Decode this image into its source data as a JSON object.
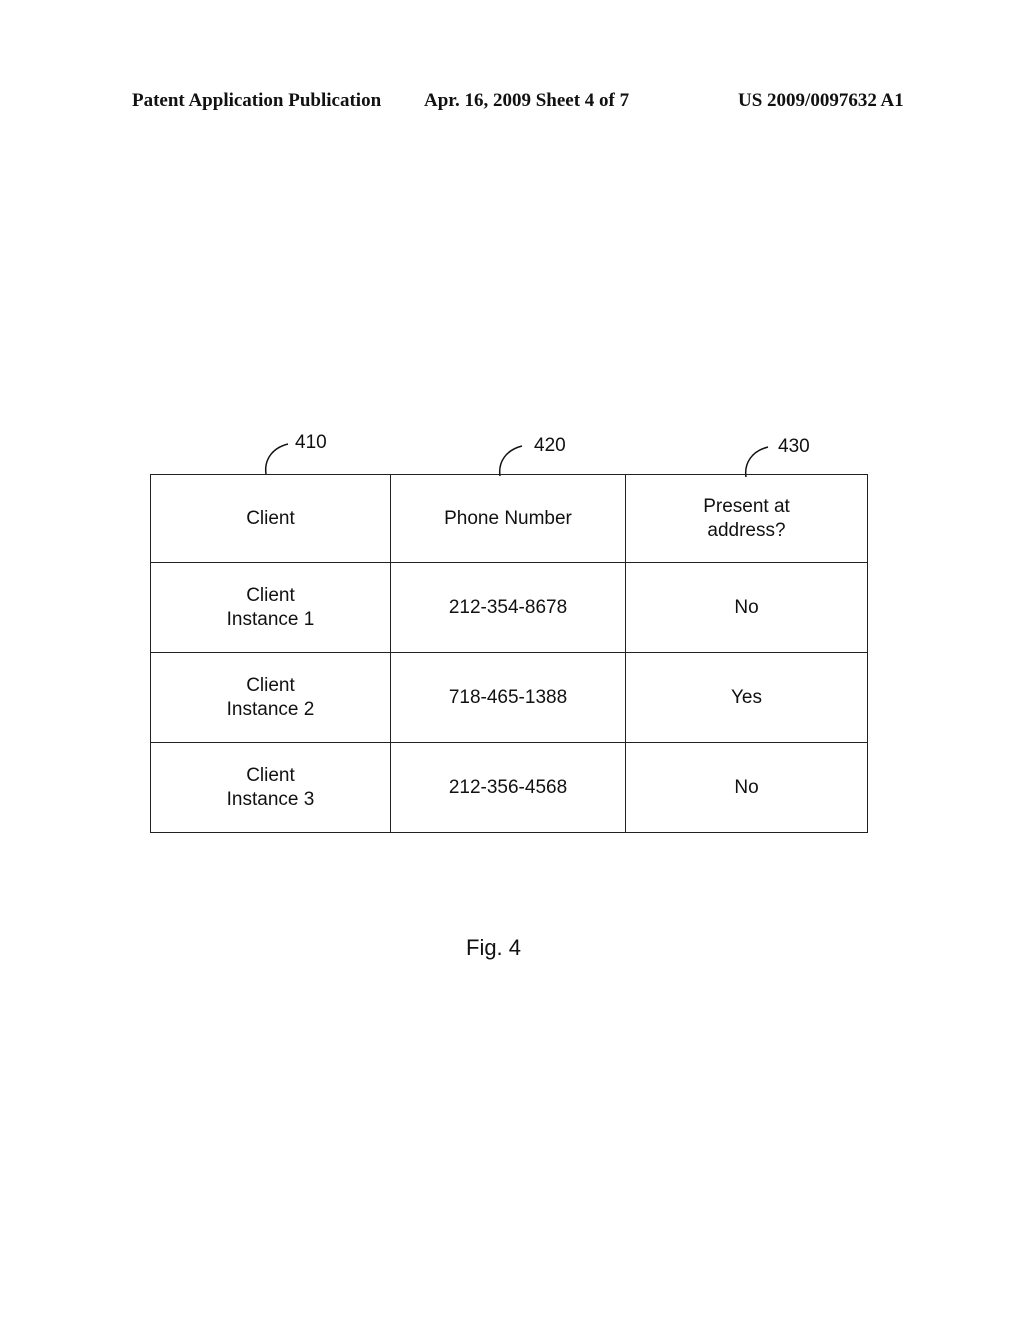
{
  "header": {
    "left": "Patent Application Publication",
    "middle": "Apr. 16, 2009  Sheet 4 of 7",
    "right": "US 2009/0097632 A1"
  },
  "figure": {
    "reference_labels": [
      "410",
      "420",
      "430"
    ],
    "table": {
      "columns": [
        "Client",
        "Phone Number",
        "Present at\naddress?"
      ],
      "column_lines": [
        [
          "Client"
        ],
        [
          "Phone Number"
        ],
        [
          "Present at",
          "address?"
        ]
      ],
      "rows": [
        {
          "client": [
            "Client",
            "Instance 1"
          ],
          "phone": "212-354-8678",
          "present": "No"
        },
        {
          "client": [
            "Client",
            "Instance 2"
          ],
          "phone": "718-465-1388",
          "present": "Yes"
        },
        {
          "client": [
            "Client",
            "Instance 3"
          ],
          "phone": "212-356-4568",
          "present": "No"
        }
      ]
    },
    "caption": "Fig. 4"
  }
}
